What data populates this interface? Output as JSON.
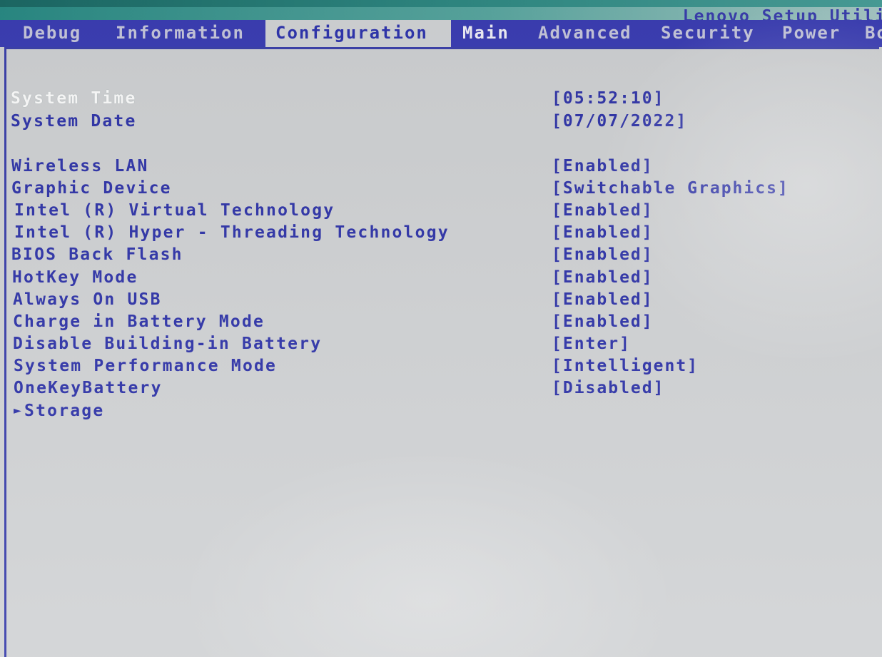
{
  "window": {
    "title": "Lenovo Setup Utili"
  },
  "tabs": [
    {
      "label": "Debug",
      "active": false
    },
    {
      "label": "Information",
      "active": false
    },
    {
      "label": "Configuration",
      "active": true
    },
    {
      "label": "Main",
      "active": false
    },
    {
      "label": "Advanced",
      "active": false
    },
    {
      "label": "Security",
      "active": false
    },
    {
      "label": "Power",
      "active": false
    },
    {
      "label": "Bo",
      "active": false
    }
  ],
  "settings": {
    "system_time": {
      "label": "System Time",
      "value": "[05:52:10]"
    },
    "system_date": {
      "label": "System Date",
      "value": "[07/07/2022]"
    },
    "items": [
      {
        "label": "Wireless LAN",
        "value": "[Enabled]"
      },
      {
        "label": "Graphic Device",
        "value": "[Switchable Graphics]"
      },
      {
        "label": "Intel (R) Virtual Technology",
        "value": "[Enabled]"
      },
      {
        "label": "Intel (R) Hyper - Threading Technology",
        "value": "[Enabled]"
      },
      {
        "label": "BIOS Back Flash",
        "value": "[Enabled]"
      },
      {
        "label": "HotKey Mode",
        "value": "[Enabled]"
      },
      {
        "label": "Always On USB",
        "value": "[Enabled]"
      },
      {
        "label": "Charge in Battery Mode",
        "value": "[Enabled]"
      },
      {
        "label": "Disable Building-in Battery",
        "value": "[Enter]"
      },
      {
        "label": "System Performance Mode",
        "value": "[Intelligent]"
      },
      {
        "label": "OneKeyBattery",
        "value": "[Disabled]"
      }
    ],
    "submenu": {
      "arrow": "►",
      "label": "Storage"
    }
  },
  "colors": {
    "tabbar": "#3c3fb6",
    "text": "#3237ab",
    "selected_text": "#ffffff",
    "background": "#d2d4d6"
  }
}
